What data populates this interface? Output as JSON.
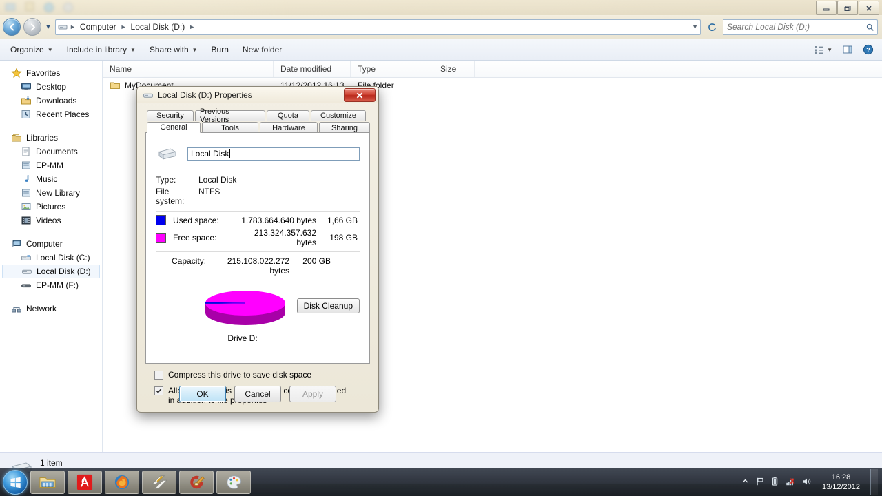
{
  "window": {
    "minimize_tooltip": "Minimize",
    "maximize_tooltip": "Restore Down",
    "close_tooltip": "Close"
  },
  "address": {
    "back_tooltip": "Back",
    "forward_tooltip": "Forward",
    "breadcrumbs": [
      "Computer",
      "Local Disk (D:)"
    ],
    "refresh_tooltip": "Refresh"
  },
  "search": {
    "placeholder": "Search Local Disk (D:)",
    "value": ""
  },
  "toolbar": {
    "organize": "Organize",
    "include_in_library": "Include in library",
    "share_with": "Share with",
    "burn": "Burn",
    "new_folder": "New folder"
  },
  "sidebar": {
    "groups": [
      {
        "title": "Favorites",
        "items": [
          {
            "label": "Desktop",
            "icon": "desktop-icon"
          },
          {
            "label": "Downloads",
            "icon": "downloads-icon"
          },
          {
            "label": "Recent Places",
            "icon": "recent-places-icon"
          }
        ]
      },
      {
        "title": "Libraries",
        "items": [
          {
            "label": "Documents",
            "icon": "documents-icon"
          },
          {
            "label": "EP-MM",
            "icon": "library-icon"
          },
          {
            "label": "Music",
            "icon": "music-icon"
          },
          {
            "label": "New Library",
            "icon": "library-icon"
          },
          {
            "label": "Pictures",
            "icon": "pictures-icon"
          },
          {
            "label": "Videos",
            "icon": "videos-icon"
          }
        ]
      },
      {
        "title": "Computer",
        "items": [
          {
            "label": "Local Disk (C:)",
            "icon": "system-drive-icon",
            "selected": false
          },
          {
            "label": "Local Disk (D:)",
            "icon": "drive-icon",
            "selected": true
          },
          {
            "label": "EP-MM (F:)",
            "icon": "removable-drive-icon",
            "selected": false
          }
        ]
      },
      {
        "title": "Network",
        "items": []
      }
    ]
  },
  "filelist": {
    "columns": [
      "Name",
      "Date modified",
      "Type",
      "Size"
    ],
    "rows": [
      {
        "name": "MyDocument",
        "date": "11/12/2012 16:13",
        "type": "File folder",
        "size": ""
      }
    ]
  },
  "status": {
    "text": "1 item"
  },
  "dialog": {
    "title": "Local Disk (D:) Properties",
    "close_label": "Close",
    "tabs_row1": [
      "Security",
      "Previous Versions",
      "Quota",
      "Customize"
    ],
    "tabs_row2": [
      "General",
      "Tools",
      "Hardware",
      "Sharing"
    ],
    "active_tab": "General",
    "volume_name": "Local Disk",
    "type_label": "Type:",
    "type_value": "Local Disk",
    "filesystem_label": "File system:",
    "filesystem_value": "NTFS",
    "used_label": "Used space:",
    "used_bytes": "1.783.664.640 bytes",
    "used_gb": "1,66 GB",
    "free_label": "Free space:",
    "free_bytes": "213.324.357.632 bytes",
    "free_gb": "198 GB",
    "capacity_label": "Capacity:",
    "capacity_bytes": "215.108.022.272 bytes",
    "capacity_gb": "200 GB",
    "drive_label": "Drive D:",
    "disk_cleanup": "Disk Cleanup",
    "compress_label": "Compress this drive to save disk space",
    "compress_checked": false,
    "index_label": "Allow files on this drive to have contents indexed in addition to file properties",
    "index_checked": true,
    "ok": "OK",
    "cancel": "Cancel",
    "apply": "Apply",
    "apply_disabled": true,
    "colors": {
      "used": "#0000ee",
      "free": "#ff00ff",
      "free_side": "#b000b0",
      "title_close": "#cf4433",
      "default_button": "#3c7fb1"
    }
  },
  "taskbar": {
    "start_label": "Start",
    "buttons": [
      {
        "name": "windows-explorer",
        "label": "Windows Explorer"
      },
      {
        "name": "avira",
        "label": "Avira"
      },
      {
        "name": "firefox",
        "label": "Mozilla Firefox"
      },
      {
        "name": "winamp",
        "label": "Winamp"
      },
      {
        "name": "ccleaner",
        "label": "CCleaner"
      },
      {
        "name": "paint",
        "label": "Paint"
      }
    ],
    "tray": [
      "show-hidden-icons",
      "action-center-flag",
      "battery",
      "volume-muted",
      "speaker"
    ],
    "time": "16:28",
    "date": "13/12/2012"
  }
}
